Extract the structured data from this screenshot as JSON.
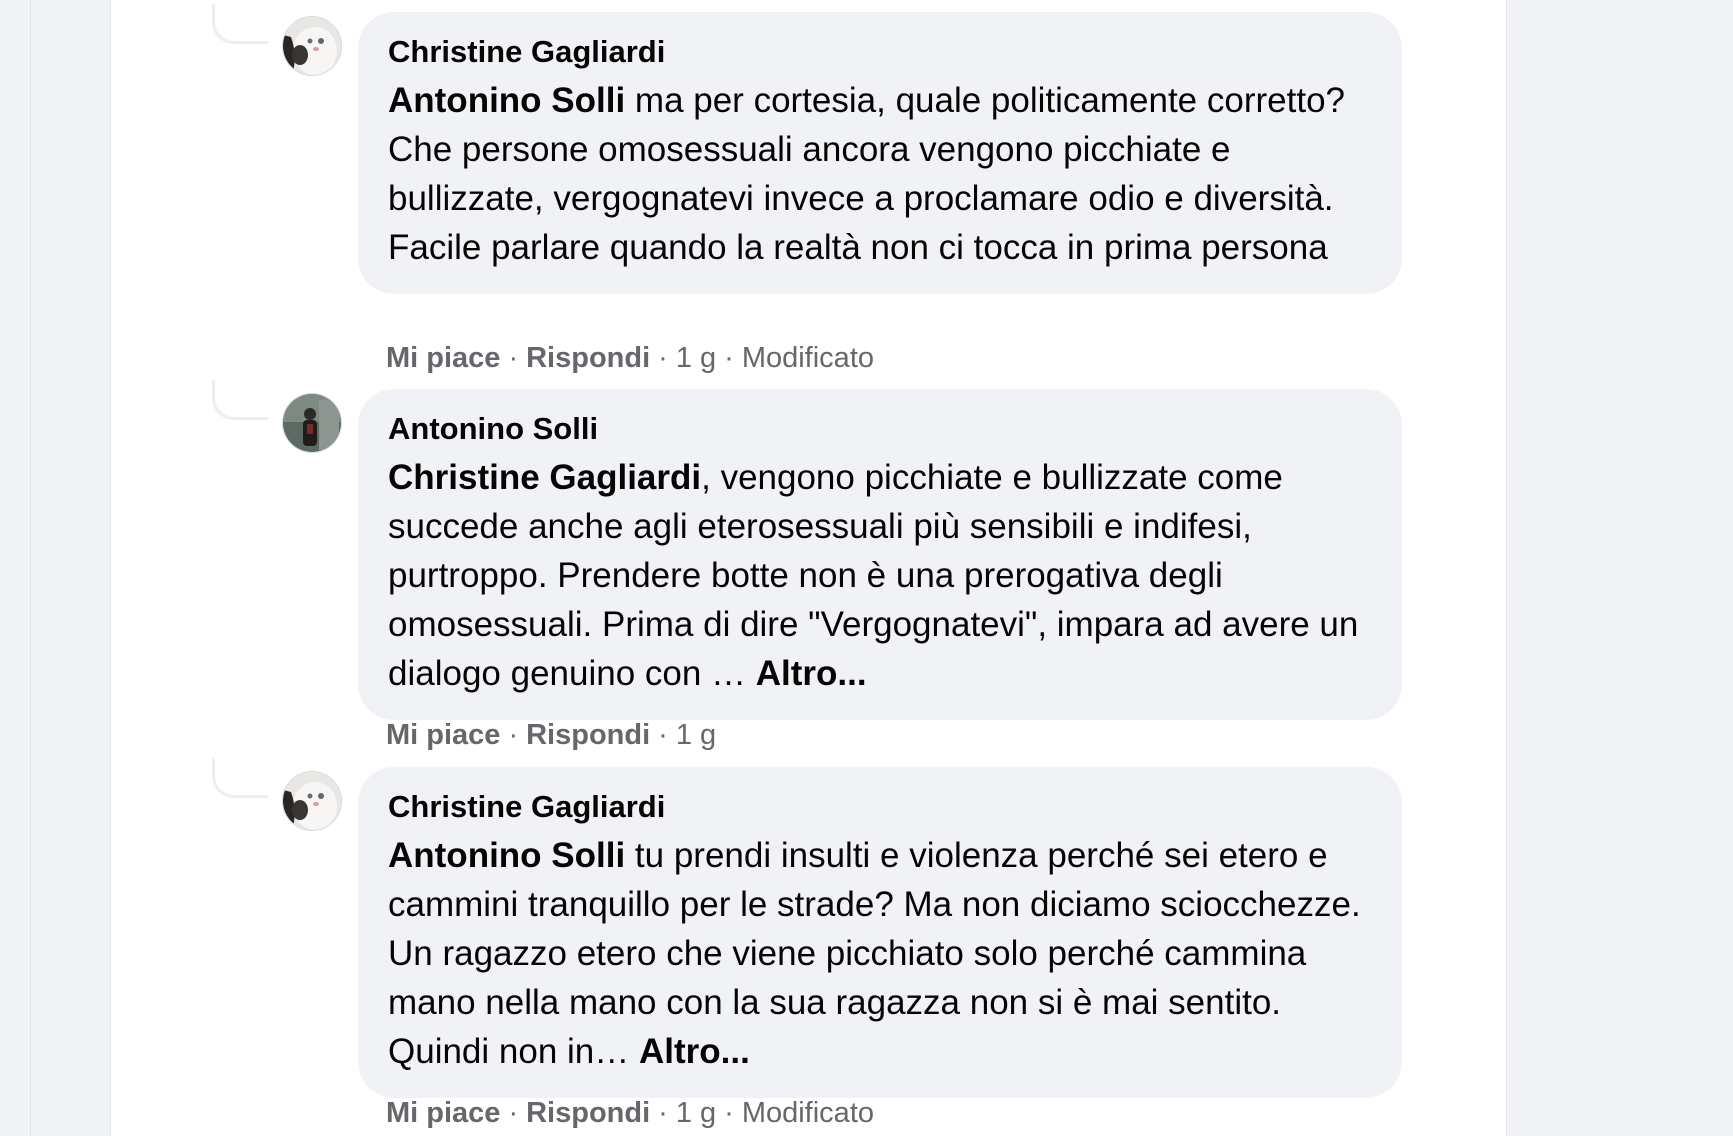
{
  "comments": [
    {
      "author": "Christine Gagliardi",
      "mention": "Antonino Solli",
      "text": " ma per cortesia, quale politicamente corretto? Che persone omosessuali ancora vengono picchiate e bullizzate, vergognatevi invece a proclamare odio e diversità. Facile parlare quando la realtà non ci tocca in prima persona",
      "more": "",
      "like": "Mi piace",
      "reply": "Rispondi",
      "time": "1 g",
      "edited": "Modificato"
    },
    {
      "author": "Antonino Solli",
      "mention": "Christine Gagliardi",
      "text": ", vengono picchiate e bullizzate come succede anche agli eterosessuali più sensibili e indifesi, purtroppo. Prendere botte non è una prerogativa degli omosessuali. Prima di dire \"Vergognatevi\", impara ad avere un dialogo genuino con … ",
      "more": "Altro...",
      "like": "Mi piace",
      "reply": "Rispondi",
      "time": "1 g",
      "edited": ""
    },
    {
      "author": "Christine Gagliardi",
      "mention": "Antonino Solli",
      "text": " tu prendi insulti e violenza perché sei etero e cammini tranquillo per le strade? Ma non diciamo sciocchezze. Un ragazzo etero che viene picchiato solo perché cammina mano nella mano con la sua ragazza non si è mai sentito. Quindi non in… ",
      "more": "Altro...",
      "like": "Mi piace",
      "reply": "Rispondi",
      "time": "1 g",
      "edited": "Modificato"
    }
  ]
}
